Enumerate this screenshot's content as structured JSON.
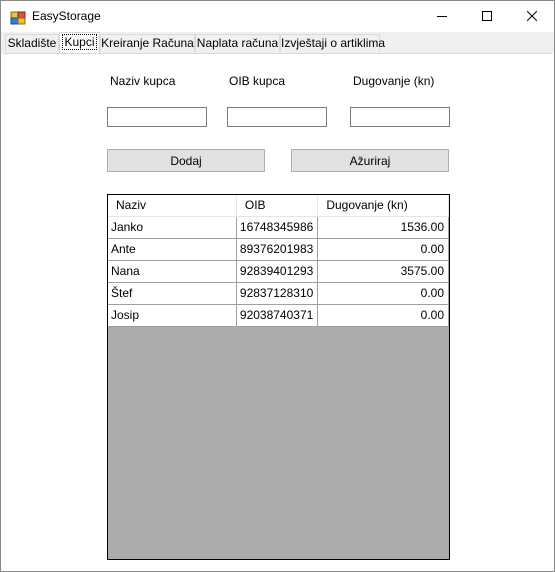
{
  "window": {
    "title": "EasyStorage",
    "icons": {
      "app": "app-icon",
      "minimize": "minimize-icon",
      "maximize": "maximize-icon",
      "close": "close-icon"
    }
  },
  "tabs": [
    {
      "label": "Skladište"
    },
    {
      "label": "Kupci"
    },
    {
      "label": "Kreiranje Računa"
    },
    {
      "label": "Naplata računa"
    },
    {
      "label": "Izvještaji o artiklima"
    }
  ],
  "form": {
    "name_label": "Naziv kupca",
    "oib_label": "OIB kupca",
    "debt_label": "Dugovanje (kn)",
    "name_value": "",
    "oib_value": "",
    "debt_value": "",
    "add_label": "Dodaj",
    "update_label": "Ažuriraj"
  },
  "grid": {
    "columns": [
      "Naziv",
      "OIB",
      "Dugovanje (kn)"
    ],
    "rows": [
      [
        "Janko",
        "16748345986",
        "1536.00"
      ],
      [
        "Ante",
        "89376201983",
        "0.00"
      ],
      [
        "Nana",
        "92839401293",
        "3575.00"
      ],
      [
        "Štef",
        "92837128310",
        "0.00"
      ],
      [
        "Josip",
        "92038740371",
        "0.00"
      ]
    ]
  }
}
